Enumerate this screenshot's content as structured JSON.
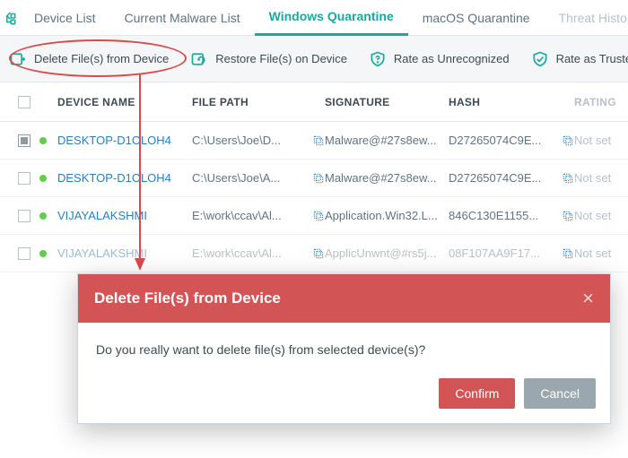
{
  "tabs": {
    "device_list": "Device List",
    "current_malware": "Current Malware List",
    "windows_q": "Windows Quarantine",
    "macos_q": "macOS Quarantine",
    "threat_history": "Threat History"
  },
  "toolbar": {
    "delete": "Delete File(s) from Device",
    "restore": "Restore File(s) on Device",
    "rate_unrec": "Rate as Unrecognized",
    "rate_trusted": "Rate as Trusted"
  },
  "headers": {
    "device": "DEVICE NAME",
    "path": "FILE PATH",
    "sig": "SIGNATURE",
    "hash": "HASH",
    "rating": "RATING"
  },
  "rows": [
    {
      "device": "DESKTOP-D1OLOH4",
      "path": "C:\\Users\\Joe\\D...",
      "sig": "Malware@#27s8ew...",
      "hash": "D27265074C9E...",
      "rating": "Not set",
      "checked": true
    },
    {
      "device": "DESKTOP-D1OLOH4",
      "path": "C:\\Users\\Joe\\A...",
      "sig": "Malware@#27s8ew...",
      "hash": "D27265074C9E...",
      "rating": "Not set",
      "checked": false
    },
    {
      "device": "VIJAYALAKSHMI",
      "path": "E:\\work\\ccav\\Al...",
      "sig": "Application.Win32.L...",
      "hash": "846C130E1155...",
      "rating": "Not set",
      "checked": false
    },
    {
      "device": "VIJAYALAKSHMI",
      "path": "E:\\work\\ccav\\Al...",
      "sig": "ApplicUnwnt@#rs5j...",
      "hash": "08F107AA9F17...",
      "rating": "Not set",
      "checked": false
    }
  ],
  "modal": {
    "title": "Delete File(s) from Device",
    "message": "Do you really want to delete file(s) from selected device(s)?",
    "confirm": "Confirm",
    "cancel": "Cancel"
  }
}
